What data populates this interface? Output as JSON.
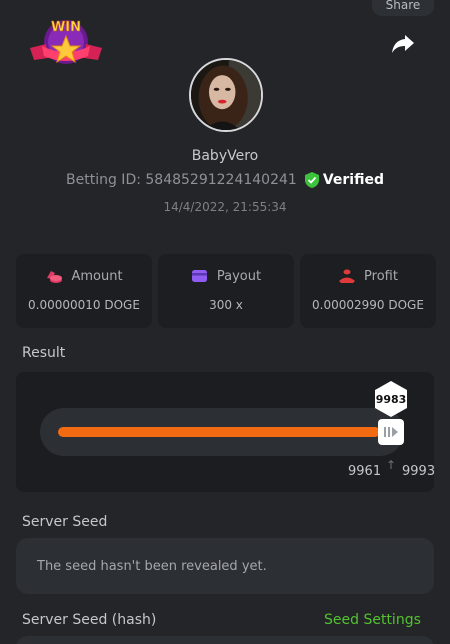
{
  "header": {
    "share_label": "Share",
    "share_icon": "share-arrow-icon",
    "badge_text": "WIN"
  },
  "profile": {
    "username": "BabyVero",
    "betting_id_label": "Betting ID: 58485291224140241",
    "verified_label": "Verified",
    "timestamp": "14/4/2022, 21:55:34"
  },
  "stats": [
    {
      "label": "Amount",
      "value": "0.00000010 DOGE",
      "icon": "coins-icon",
      "color": "#e03b63"
    },
    {
      "label": "Payout",
      "value": "300 x",
      "icon": "card-icon",
      "color": "#8e5cf0"
    },
    {
      "label": "Profit",
      "value": "0.00002990 DOGE",
      "icon": "bag-icon",
      "color": "#e03b3b"
    }
  ],
  "result": {
    "label": "Result",
    "value": "9983",
    "range_low": "9961",
    "range_high": "9993",
    "fill_fraction": 0.97,
    "accent": "#f26b12"
  },
  "server_seed": {
    "label": "Server Seed",
    "placeholder": "The seed hasn't been revealed yet."
  },
  "server_seed_hash": {
    "label": "Server Seed (hash)",
    "settings_link": "Seed Settings",
    "link_color": "#53c22f"
  }
}
